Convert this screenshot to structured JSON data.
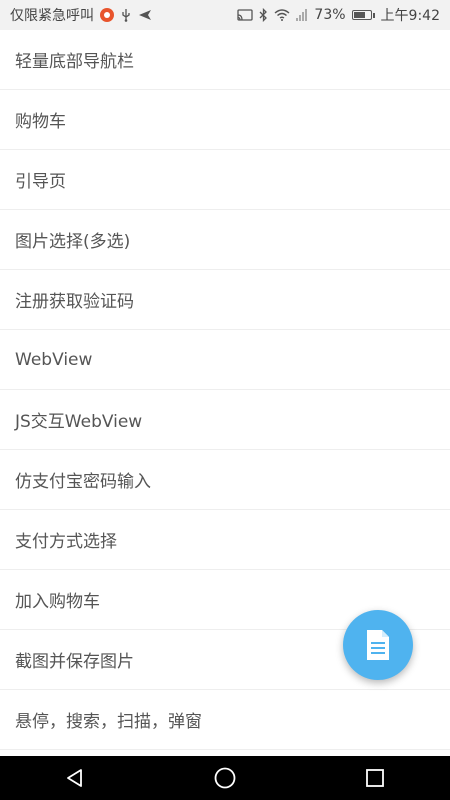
{
  "status_bar": {
    "left_text": "仅限紧急呼叫",
    "battery_percent": "73%",
    "battery_level": 0.73,
    "time": "上午9:42",
    "icons_left": [
      "weibo-icon",
      "usb-icon",
      "send-icon"
    ],
    "icons_right": [
      "cast-icon",
      "bluetooth-icon",
      "wifi-icon",
      "signal-icon",
      "battery-icon"
    ]
  },
  "list": {
    "items": [
      {
        "label": "轻量底部导航栏"
      },
      {
        "label": "购物车"
      },
      {
        "label": "引导页"
      },
      {
        "label": "图片选择(多选)"
      },
      {
        "label": "注册获取验证码"
      },
      {
        "label": "WebView"
      },
      {
        "label": "JS交互WebView"
      },
      {
        "label": "仿支付宝密码输入"
      },
      {
        "label": "支付方式选择"
      },
      {
        "label": "加入购物车"
      },
      {
        "label": "截图并保存图片"
      },
      {
        "label": "悬停，搜索，扫描，弹窗"
      }
    ]
  },
  "fab": {
    "icon": "document-icon",
    "color": "#4fb3ef"
  },
  "nav_bar": {
    "buttons": [
      "back-icon",
      "home-icon",
      "recents-icon"
    ]
  },
  "colors": {
    "accent": "#4fb3ef",
    "text": "#555555",
    "divider": "#eeeeee",
    "status_bg": "#f2f2f2"
  }
}
